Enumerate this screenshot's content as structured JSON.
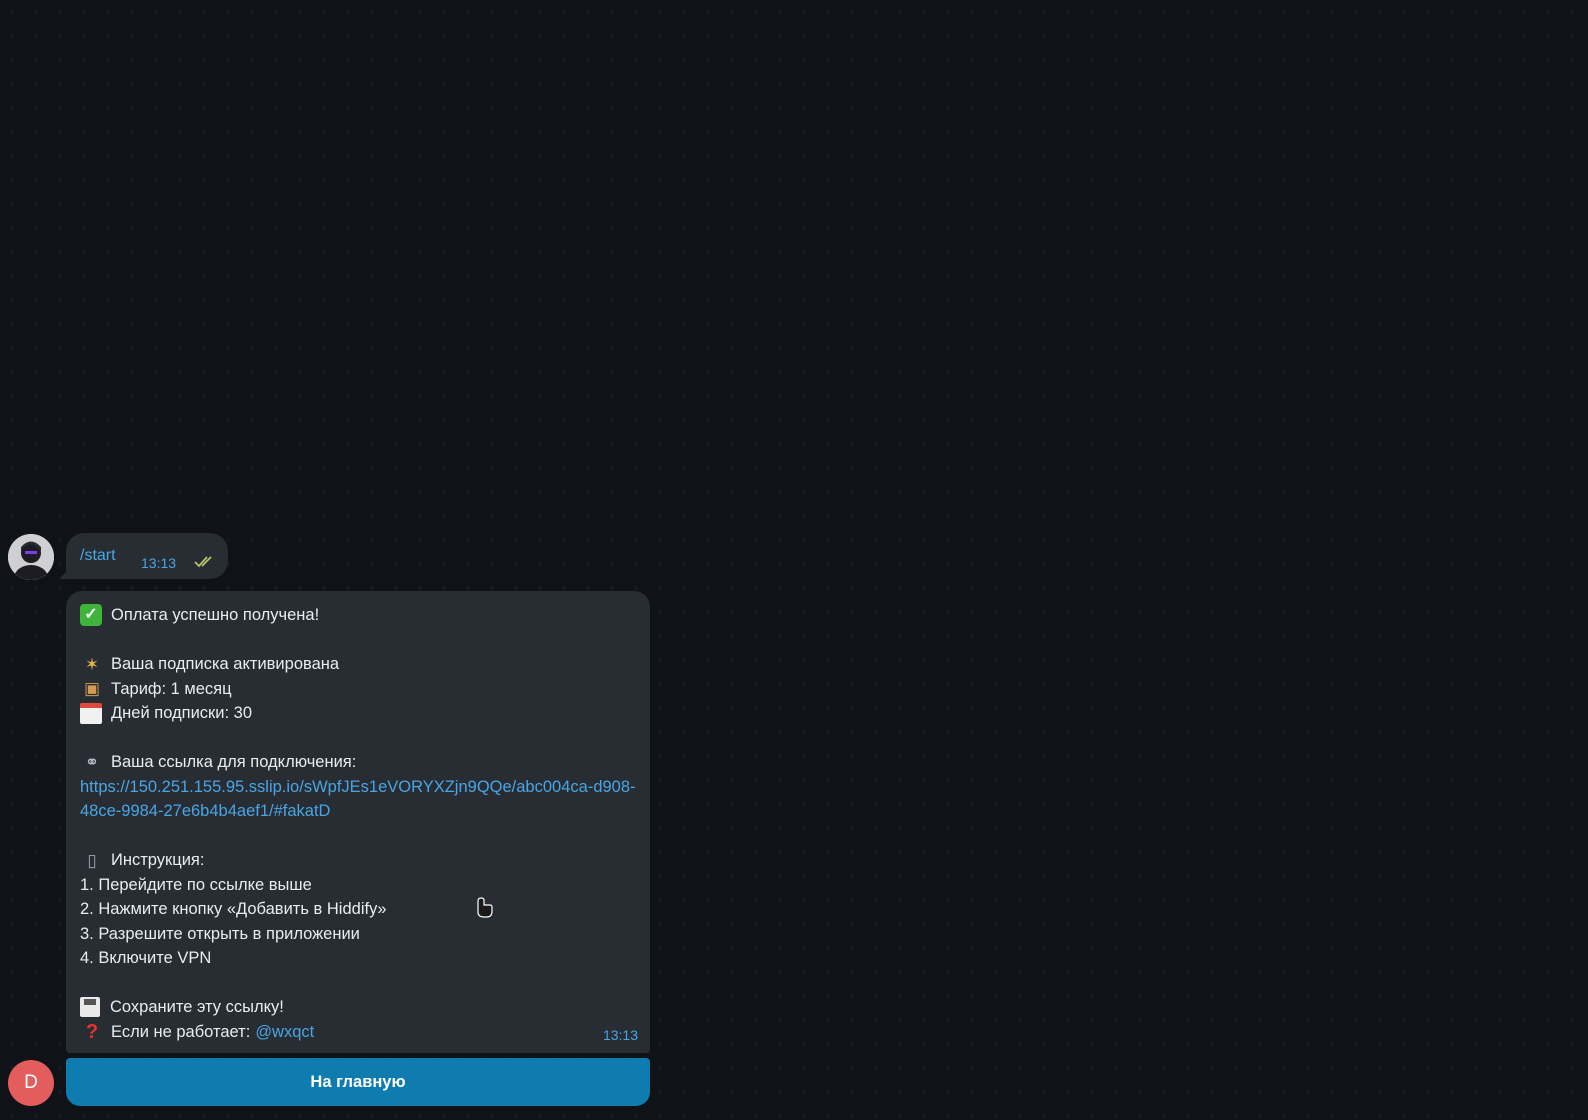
{
  "chat": {
    "outgoing": {
      "command": "/start",
      "time": "13:13"
    },
    "incoming": {
      "lines": {
        "payment": "Оплата успешно получена!",
        "activated": "Ваша подписка активирована",
        "tariff": "Тариф: 1 месяц",
        "days": "Дней подписки: 30",
        "link_label": "Ваша ссылка для подключения:",
        "link_url": "https://150.251.155.95.sslip.io/sWpfJEs1eVORYXZjn9QQe/abc004ca-d908-48ce-9984-27e6b4b4aef1/#fakatD",
        "instruction_title": "Инструкция:",
        "step1": "1. Перейдите по ссылке выше",
        "step2": "2. Нажмите кнопку «Добавить в Hiddify»",
        "step3": "3. Разрешите открыть в приложении",
        "step4": "4. Включите VPN",
        "save": "Сохраните эту ссылку!",
        "support_label": "Если не работает:",
        "support_mention": "@wxqct"
      },
      "time": "13:13"
    },
    "button_label": "На главную",
    "bot_avatar_letter": "D"
  },
  "colors": {
    "background": "#0f1216",
    "bubble": "#272d33",
    "accent": "#4aa5e4",
    "button": "#0f7cb0",
    "bot_avatar": "#e35d5d"
  },
  "icons": {
    "payment": "check-mark-button-icon",
    "activated": "party-popper-icon",
    "tariff": "package-icon",
    "days": "calendar-icon",
    "link": "link-icon",
    "instruction": "mobile-phone-icon",
    "save": "floppy-disk-icon",
    "support": "question-mark-icon",
    "read_status": "double-check-icon",
    "cursor": "mouse-cursor-icon"
  }
}
